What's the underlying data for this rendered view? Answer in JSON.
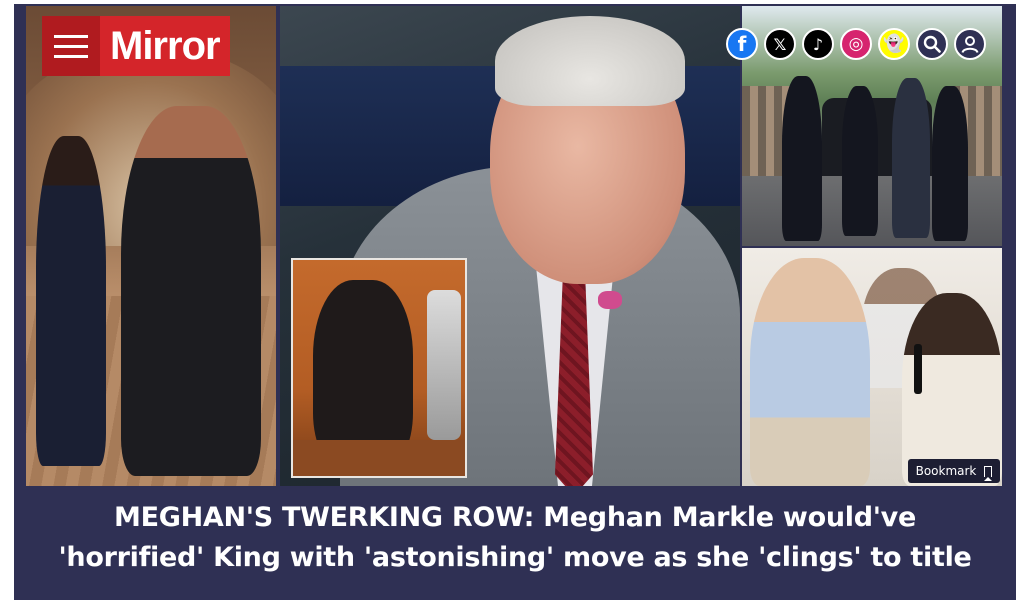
{
  "brand": {
    "logo_text": "Mirror"
  },
  "social": {
    "facebook_glyph": "f",
    "x_glyph": "𝕏",
    "tiktok_glyph": "♪",
    "instagram_glyph": "◎",
    "snapchat_glyph": "👻",
    "icons": [
      "facebook-icon",
      "x-icon",
      "tiktok-icon",
      "instagram-icon",
      "snapchat-icon",
      "search-icon",
      "user-icon"
    ]
  },
  "article": {
    "bookmark_label": "Bookmark",
    "headline_line1": "MEGHAN'S TWERKING ROW: Meghan Markle would've",
    "headline_line2": "'horrified' King with 'astonishing' move as she 'clings' to title"
  },
  "colors": {
    "brand_red": "#d4252a",
    "panel_bg": "#2f3054"
  }
}
